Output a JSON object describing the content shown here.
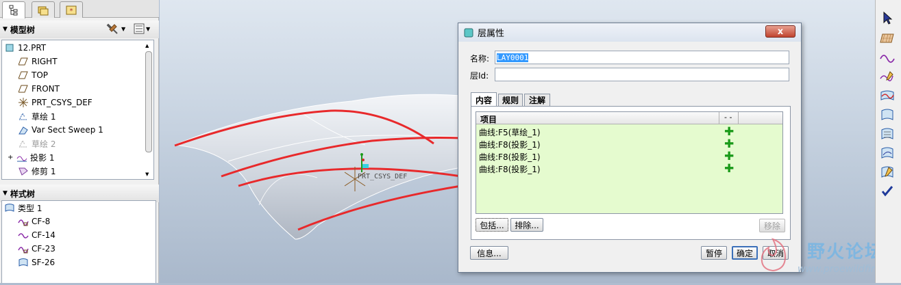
{
  "model_tree": {
    "title": "模型树",
    "items": [
      {
        "label": "12.PRT",
        "icon": "part-icon",
        "state": "normal"
      },
      {
        "label": "RIGHT",
        "icon": "datum-plane-icon",
        "state": "normal"
      },
      {
        "label": "TOP",
        "icon": "datum-plane-icon",
        "state": "normal"
      },
      {
        "label": "FRONT",
        "icon": "datum-plane-icon",
        "state": "normal"
      },
      {
        "label": "PRT_CSYS_DEF",
        "icon": "csys-icon",
        "state": "normal"
      },
      {
        "label": "草绘 1",
        "icon": "sketch-icon",
        "state": "normal"
      },
      {
        "label": "Var Sect Sweep 1",
        "icon": "sweep-icon",
        "state": "normal"
      },
      {
        "label": "草绘 2",
        "icon": "sketch-icon",
        "state": "suppressed"
      },
      {
        "label": "投影 1",
        "icon": "projection-icon",
        "state": "normal"
      },
      {
        "label": "修剪 1",
        "icon": "trim-icon",
        "state": "normal"
      }
    ]
  },
  "style_tree": {
    "title": "样式树",
    "items": [
      {
        "label": "类型 1",
        "icon": "style-type-icon"
      },
      {
        "label": "CF-8",
        "icon": "free-curve-icon"
      },
      {
        "label": "CF-14",
        "icon": "free-curve-icon"
      },
      {
        "label": "CF-23",
        "icon": "free-curve-icon"
      },
      {
        "label": "SF-26",
        "icon": "surface-icon"
      }
    ]
  },
  "viewport": {
    "csys_label": "PRT_CSYS_DEF",
    "curve_color": "#e8292b"
  },
  "dialog": {
    "title": "层属性",
    "close_label": "x",
    "name_label": "名称:",
    "name_value": "LAY0001",
    "id_label": "层Id:",
    "id_value": "",
    "tabs": [
      "内容",
      "规则",
      "注解"
    ],
    "list_header": "项目",
    "list_header_col2": "- -",
    "items": [
      {
        "label": "曲线:F5(草绘_1)",
        "status": "plus-icon"
      },
      {
        "label": "曲线:F8(投影_1)",
        "status": "plus-icon"
      },
      {
        "label": "曲线:F8(投影_1)",
        "status": "plus-icon"
      },
      {
        "label": "曲线:F8(投影_1)",
        "status": "plus-icon"
      }
    ],
    "include_label": "包括...",
    "exclude_label": "排除...",
    "remove_label": "移除",
    "info_label": "信息...",
    "pause_label": "暂停",
    "ok_label": "确定",
    "cancel_label": "取消"
  },
  "watermark": {
    "title": "野火论坛",
    "url": "www.proewildfire.cn"
  }
}
